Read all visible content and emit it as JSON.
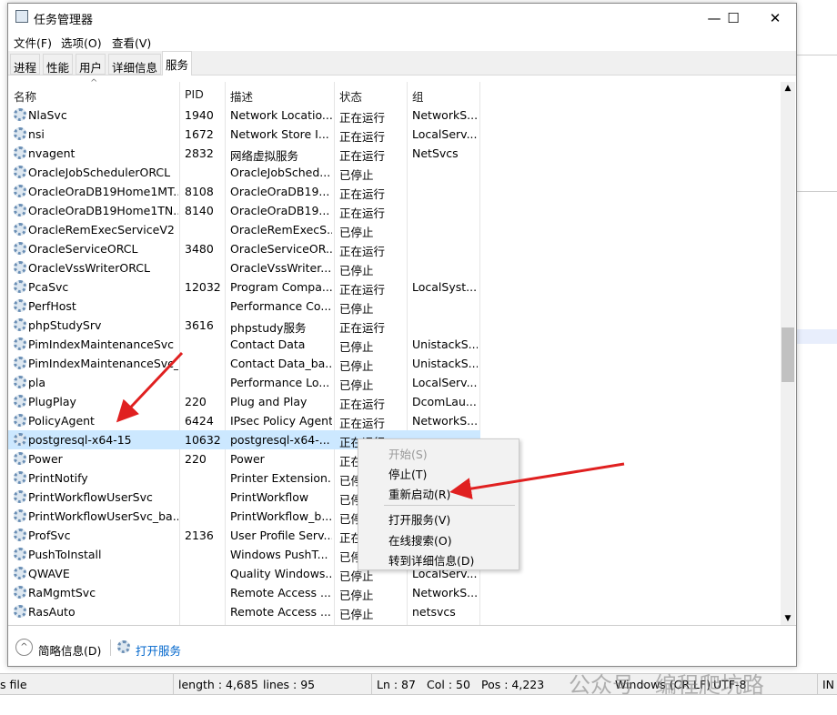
{
  "window": {
    "title": "任务管理器",
    "minimize": "—",
    "maximize": "☐",
    "close": "✕"
  },
  "menu": [
    "文件(F)",
    "选项(O)",
    "查看(V)"
  ],
  "tabs": [
    "进程",
    "性能",
    "用户",
    "详细信息",
    "服务"
  ],
  "active_tab": "服务",
  "columns": [
    "名称",
    "PID",
    "描述",
    "状态",
    "组"
  ],
  "rows": [
    [
      "NlaSvc",
      "1940",
      "Network Locatio...",
      "正在运行",
      "NetworkS..."
    ],
    [
      "nsi",
      "1672",
      "Network Store I...",
      "正在运行",
      "LocalServ..."
    ],
    [
      "nvagent",
      "2832",
      "网络虚拟服务",
      "正在运行",
      "NetSvcs"
    ],
    [
      "OracleJobSchedulerORCL",
      "",
      "OracleJobSched...",
      "已停止",
      ""
    ],
    [
      "OracleOraDB19Home1MT...",
      "8108",
      "OracleOraDB19...",
      "正在运行",
      ""
    ],
    [
      "OracleOraDB19Home1TN...",
      "8140",
      "OracleOraDB19...",
      "正在运行",
      ""
    ],
    [
      "OracleRemExecServiceV2",
      "",
      "OracleRemExecS...",
      "已停止",
      ""
    ],
    [
      "OracleServiceORCL",
      "3480",
      "OracleServiceOR...",
      "正在运行",
      ""
    ],
    [
      "OracleVssWriterORCL",
      "",
      "OracleVssWriter...",
      "已停止",
      ""
    ],
    [
      "PcaSvc",
      "12032",
      "Program Compa...",
      "正在运行",
      "LocalSyst..."
    ],
    [
      "PerfHost",
      "",
      "Performance Co...",
      "已停止",
      ""
    ],
    [
      "phpStudySrv",
      "3616",
      "phpstudy服务",
      "正在运行",
      ""
    ],
    [
      "PimIndexMaintenanceSvc",
      "",
      "Contact Data",
      "已停止",
      "UnistackS..."
    ],
    [
      "PimIndexMaintenanceSvc_...",
      "",
      "Contact Data_ba...",
      "已停止",
      "UnistackS..."
    ],
    [
      "pla",
      "",
      "Performance Lo...",
      "已停止",
      "LocalServ..."
    ],
    [
      "PlugPlay",
      "220",
      "Plug and Play",
      "正在运行",
      "DcomLau..."
    ],
    [
      "PolicyAgent",
      "6424",
      "IPsec Policy Agent",
      "正在运行",
      "NetworkS..."
    ],
    [
      "postgresql-x64-15",
      "10632",
      "postgresql-x64-...",
      "正在运行",
      ""
    ],
    [
      "Power",
      "220",
      "Power",
      "正在运行",
      ""
    ],
    [
      "PrintNotify",
      "",
      "Printer Extension...",
      "已停止",
      ""
    ],
    [
      "PrintWorkflowUserSvc",
      "",
      "PrintWorkflow",
      "已停止",
      ""
    ],
    [
      "PrintWorkflowUserSvc_ba...",
      "",
      "PrintWorkflow_b...",
      "已停止",
      ""
    ],
    [
      "ProfSvc",
      "2136",
      "User Profile Serv...",
      "正在运行",
      ""
    ],
    [
      "PushToInstall",
      "",
      "Windows PushT...",
      "已停止",
      ""
    ],
    [
      "QWAVE",
      "",
      "Quality Windows...",
      "已停止",
      "LocalServ..."
    ],
    [
      "RaMgmtSvc",
      "",
      "Remote Access ...",
      "已停止",
      "NetworkS..."
    ],
    [
      "RasAuto",
      "",
      "Remote Access ...",
      "已停止",
      "netsvcs"
    ]
  ],
  "selected_row": "postgresql-x64-15",
  "context_menu": [
    "开始(S)",
    "停止(T)",
    "重新启动(R)",
    "打开服务(V)",
    "在线搜索(O)",
    "转到详细信息(D)"
  ],
  "footer": {
    "less_details": "简略信息(D)",
    "open_services": "打开服务"
  },
  "statusbar": {
    "file": "s file",
    "length": "length : 4,685",
    "lines": "lines : 95",
    "ln": "Ln : 87",
    "col": "Col : 50",
    "pos": "Pos : 4,223",
    "eol": "Windows (CR LF)",
    "enc": "UTF-8",
    "ins": "IN"
  },
  "watermark": "公众号 · 编程爬坑路",
  "colors": {
    "selection": "#cce8ff",
    "arrow": "#e02020",
    "link": "#0066cc"
  }
}
